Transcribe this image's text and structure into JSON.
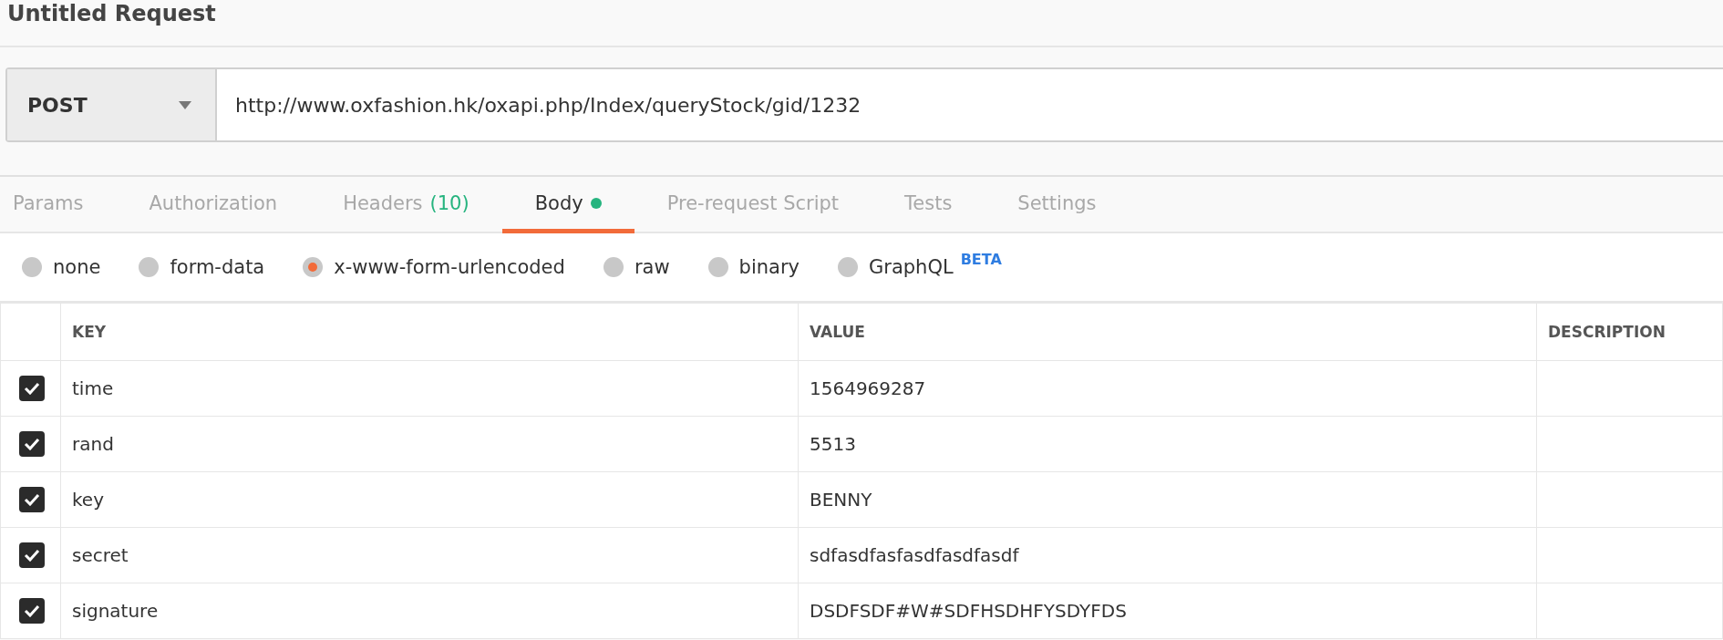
{
  "title": "Untitled Request",
  "request": {
    "method": "POST",
    "url": "http://www.oxfashion.hk/oxapi.php/Index/queryStock/gid/1232"
  },
  "tabs": [
    {
      "label": "Params",
      "selected": false
    },
    {
      "label": "Authorization",
      "selected": false
    },
    {
      "label": "Headers",
      "count": "(10)",
      "selected": false
    },
    {
      "label": "Body",
      "dot": true,
      "selected": true
    },
    {
      "label": "Pre-request Script",
      "selected": false
    },
    {
      "label": "Tests",
      "selected": false
    },
    {
      "label": "Settings",
      "selected": false
    }
  ],
  "body_types": [
    {
      "label": "none",
      "selected": false
    },
    {
      "label": "form-data",
      "selected": false
    },
    {
      "label": "x-www-form-urlencoded",
      "selected": true
    },
    {
      "label": "raw",
      "selected": false
    },
    {
      "label": "binary",
      "selected": false
    },
    {
      "label": "GraphQL",
      "badge": "BETA",
      "selected": false
    }
  ],
  "table": {
    "columns": [
      "KEY",
      "VALUE",
      "DESCRIPTION"
    ],
    "rows": [
      {
        "checked": true,
        "key": "time",
        "value": "1564969287"
      },
      {
        "checked": true,
        "key": "rand",
        "value": "5513"
      },
      {
        "checked": true,
        "key": "key",
        "value": "BENNY"
      },
      {
        "checked": true,
        "key": "secret",
        "value": "sdfasdfasfasdfasdfasdf"
      },
      {
        "checked": true,
        "key": "signature",
        "value": "DSDFSDF#W#SDFHSDHFYSDYFDS"
      }
    ]
  }
}
